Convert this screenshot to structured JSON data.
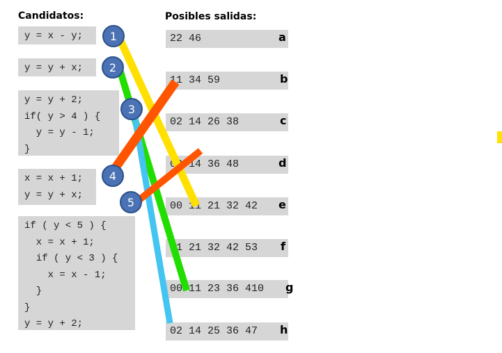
{
  "candidates_heading": "Candidatos:",
  "outputs_heading": "Posibles salidas:",
  "snippets": [
    [
      "y = x - y;"
    ],
    [
      "y = y + x;"
    ],
    [
      "y = y + 2;",
      "if( y > 4 ) {",
      "  y = y - 1;",
      "}"
    ],
    [
      "x = x + 1;",
      "y = y + x;"
    ],
    [
      "if ( y < 5 ) {",
      "  x = x + 1;",
      "  if ( y < 3 ) {",
      "    x = x - 1;",
      "  }",
      "}",
      "y = y + 2;"
    ]
  ],
  "outputs": [
    {
      "seq": "22 46",
      "letter": "a"
    },
    {
      "seq": "11 34 59",
      "letter": "b"
    },
    {
      "seq": "02 14 26 38",
      "letter": "c"
    },
    {
      "seq": "02 14 36 48",
      "letter": "d"
    },
    {
      "seq": "00 11 21 32 42",
      "letter": "e"
    },
    {
      "seq": "11 21 32 42 53",
      "letter": "f"
    },
    {
      "seq": "00 11 23 36 410",
      "letter": "g"
    },
    {
      "seq": "02 14 25 36 47",
      "letter": "h"
    }
  ],
  "badges": [
    "1",
    "2",
    "3",
    "4",
    "5"
  ],
  "matches": [
    {
      "badge": "1",
      "output": "e",
      "color": "#ffe000"
    },
    {
      "badge": "2",
      "output": "g",
      "color": "#22dd00"
    },
    {
      "badge": "3",
      "output": "h",
      "color": "#44c4f0"
    },
    {
      "badge": "4",
      "output": "b",
      "color": "#ff5500"
    },
    {
      "badge": "5",
      "output": "d",
      "color": "#ff5500"
    }
  ],
  "colors": {
    "box": "#d6d6d6",
    "badge": "#4a72b4",
    "stray_mark": "#ffe000"
  }
}
